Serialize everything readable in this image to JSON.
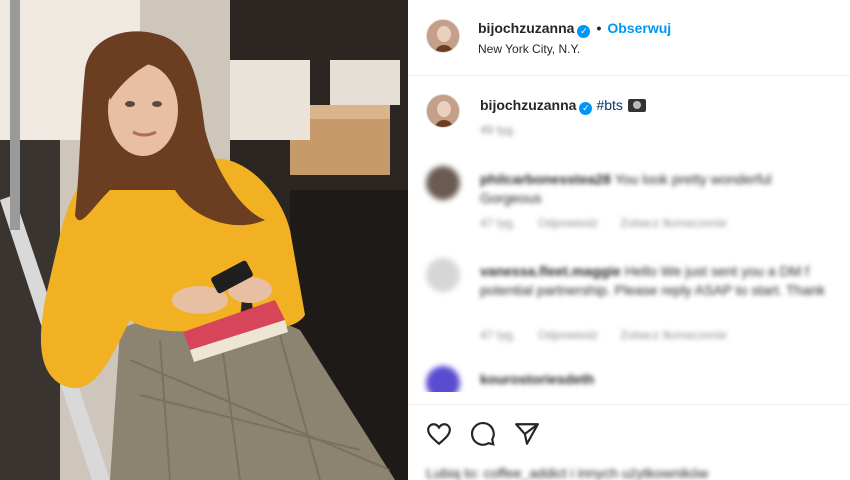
{
  "post": {
    "header": {
      "username": "bijochzuzanna",
      "separator": "•",
      "follow_label": "Obserwuj",
      "location": "New York City, N.Y."
    },
    "caption": {
      "username": "bijochzuzanna",
      "hashtag": "#bts",
      "time": "49 tyg."
    },
    "comments": [
      {
        "username": "philcarbonesstea28",
        "text": "You look pretty wonderful",
        "text2": "Gorgeous",
        "time": "47 tyg.",
        "reply_label": "Odpowiedz",
        "translate_label": "Zobacz tłumaczenie",
        "avatar_color": "#6b5a52"
      },
      {
        "username": "vanessa.fleet.maggie",
        "text": "Hello We just sent you a DM f",
        "text2": "potential partnership. Please reply ASAP to start. Thank",
        "time": "47 tyg.",
        "reply_label": "Odpowiedz",
        "translate_label": "Zobacz tłumaczenie",
        "avatar_color": "#d6d6d6"
      },
      {
        "username": "kourostoriesdeth",
        "text": "",
        "avatar_color": "#5a4bd1"
      }
    ],
    "likes_text": "Lubią to: coffee_addict i innych użytkowników"
  },
  "icons": [
    "heart-icon",
    "comment-icon",
    "share-icon",
    "verified-icon",
    "camera-emoji"
  ],
  "colors": {
    "accent": "#0095f6",
    "hashtag": "#00376b",
    "sweater": "#f1b122"
  }
}
